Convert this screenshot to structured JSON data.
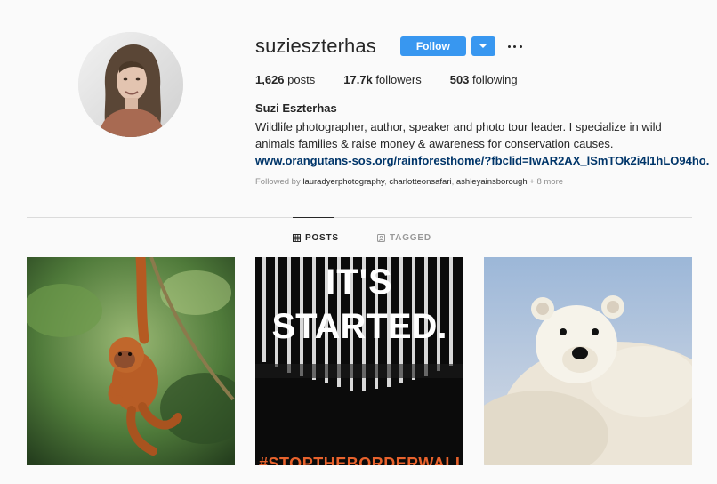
{
  "profile": {
    "username": "suzieszterhas",
    "follow_label": "Follow",
    "full_name": "Suzi Eszterhas",
    "bio": "Wildlife photographer, author, speaker and photo tour leader. I specialize in wild animals families & raise money & awareness for conservation causes.",
    "link": "www.orangutans-sos.org/rainforesthome/?fbclid=IwAR2AX_lSmTOk2i4l1hLO94ho...",
    "stats": {
      "posts_count": "1,626",
      "posts_label": "posts",
      "followers_count": "17.7k",
      "followers_label": "followers",
      "following_count": "503",
      "following_label": "following"
    },
    "followed_by": {
      "prefix": "Followed by",
      "accounts": [
        "lauradyerphotography",
        "charlotteonsafari",
        "ashleyainsborough"
      ],
      "more": "+ 8 more"
    }
  },
  "tabs": [
    {
      "label": "POSTS",
      "icon": "grid-icon",
      "active": true
    },
    {
      "label": "TAGGED",
      "icon": "tag-icon",
      "active": false
    }
  ],
  "posts": [
    {
      "subject": "orangutan-photo"
    },
    {
      "subject": "its-started-graphic",
      "line1": "IT'S",
      "line2": "STARTED.",
      "hashtag": "#STOPTHEBORDERWALL"
    },
    {
      "subject": "polar-bear-cub-photo"
    }
  ],
  "colors": {
    "accent": "#3897f0",
    "link": "#003569",
    "muted": "#8e8e8e",
    "hashtag": "#e8622c"
  }
}
